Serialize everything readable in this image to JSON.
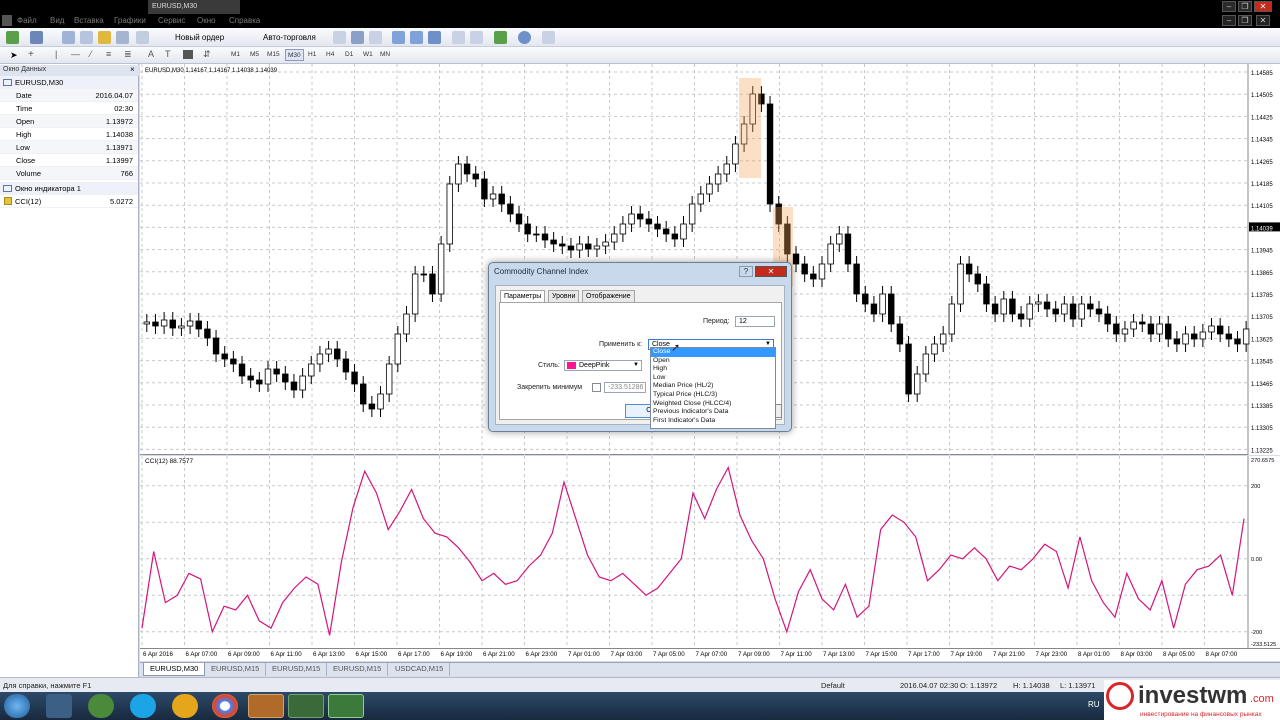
{
  "window": {
    "doc_tab": "EURUSD,M30"
  },
  "menu": [
    "Файл",
    "Вид",
    "Вставка",
    "Графики",
    "Сервис",
    "Окно",
    "Справка"
  ],
  "toolbar1": {
    "new_order": "Новый ордер",
    "auto_trading": "Авто-торговля"
  },
  "timeframes": [
    "M1",
    "M5",
    "M15",
    "M30",
    "H1",
    "H4",
    "D1",
    "W1",
    "MN"
  ],
  "active_timeframe": "M30",
  "datawin": {
    "header": "Окно Данных",
    "symbol": "EURUSD,M30",
    "rows": [
      {
        "k": "Date",
        "v": "2016.04.07"
      },
      {
        "k": "Time",
        "v": "02:30"
      },
      {
        "k": "Open",
        "v": "1.13972"
      },
      {
        "k": "High",
        "v": "1.14038"
      },
      {
        "k": "Low",
        "v": "1.13971"
      },
      {
        "k": "Close",
        "v": "1.13997"
      },
      {
        "k": "Volume",
        "v": "766"
      }
    ],
    "indicator_header": "Окно индикатора 1",
    "indicator_name": "CCI(12)",
    "indicator_value": "5.0272"
  },
  "chart": {
    "header": "EURUSD,M30  1.14167 1.14167 1.14038 1.14039",
    "price_labels": [
      "1.14585",
      "1.14505",
      "1.14425",
      "1.14345",
      "1.14265",
      "1.14185",
      "1.14105",
      "1.14039",
      "1.13945",
      "1.13865",
      "1.13785",
      "1.13705",
      "1.13625",
      "1.13545",
      "1.13465",
      "1.13385",
      "1.13305",
      "1.13225"
    ],
    "current_price": "1.14039",
    "cci_header": "CCI(12) 88.7577",
    "cci_labels": [
      "270.6575",
      "200",
      "0.00",
      "-200",
      "-233.5125"
    ],
    "time_labels": [
      "6 Apr 2016",
      "6 Apr 07:00",
      "6 Apr 09:00",
      "6 Apr 11:00",
      "6 Apr 13:00",
      "6 Apr 15:00",
      "6 Apr 17:00",
      "6 Apr 19:00",
      "6 Apr 21:00",
      "6 Apr 23:00",
      "7 Apr 01:00",
      "7 Apr 03:00",
      "7 Apr 05:00",
      "7 Apr 07:00",
      "7 Apr 09:00",
      "7 Apr 11:00",
      "7 Apr 13:00",
      "7 Apr 15:00",
      "7 Apr 17:00",
      "7 Apr 19:00",
      "7 Apr 21:00",
      "7 Apr 23:00",
      "8 Apr 01:00",
      "8 Apr 03:00",
      "8 Apr 05:00",
      "8 Apr 07:00"
    ],
    "cci_color": "#d4147a"
  },
  "chart_data": {
    "type": "line",
    "title": "CCI(12) 88.7577",
    "series": [
      {
        "name": "CCI(12)",
        "values": [
          -190,
          20,
          -120,
          -100,
          -40,
          -55,
          -200,
          -130,
          -140,
          -100,
          -170,
          -190,
          -120,
          -80,
          -50,
          -70,
          -210,
          -10,
          140,
          240,
          180,
          80,
          130,
          190,
          110,
          70,
          60,
          30,
          -10,
          -60,
          -40,
          -70,
          -60,
          -20,
          10,
          70,
          210,
          110,
          10,
          -50,
          -60,
          -40,
          -70,
          -100,
          -80,
          -40,
          0,
          180,
          110,
          190,
          250,
          120,
          50,
          0,
          -110,
          -200,
          -90,
          -30,
          -110,
          -140,
          -70,
          -160,
          -130,
          80,
          120,
          100,
          60,
          -60,
          -30,
          10,
          0,
          30,
          0,
          -60,
          -20,
          -30,
          0,
          40,
          20,
          -80,
          60,
          -60,
          -120,
          -160,
          -40,
          -110,
          -140,
          -60,
          -190,
          -70,
          -30,
          -20,
          10,
          -100,
          110
        ]
      }
    ],
    "ylim": [
      -233.5125,
      270.6575
    ]
  },
  "chart_tabs": [
    "EURUSD,M30",
    "EURUSD,M15",
    "EURUSD,M15",
    "EURUSD,M15",
    "USDCAD,M15"
  ],
  "status": {
    "help": "Для справки, нажмите F1",
    "profile": "Default",
    "datetime": "2016.04.07 02:30",
    "o": "O: 1.13972",
    "h": "H: 1.14038",
    "l": "L: 1.13971"
  },
  "dialog": {
    "title": "Commodity Channel Index",
    "tabs": [
      "Параметры",
      "Уровни",
      "Отображение"
    ],
    "period_label": "Период:",
    "period_value": "12",
    "apply_label": "Применить к:",
    "apply_value": "Close",
    "style_label": "Стиль:",
    "style_value": "DeepPink",
    "fix_min_label": "Закрепить минимум",
    "fix_min_value": "-233.51286",
    "ok_label": "O",
    "options": [
      "Close",
      "Open",
      "High",
      "Low",
      "Median Price (HL/2)",
      "Typical Price (HLC/3)",
      "Weighted Close (HLCC/4)",
      "Previous Indicator's Data",
      "First Indicator's Data"
    ]
  },
  "taskbar": {
    "lang": "RU"
  },
  "brand": {
    "name": "investwm",
    "suffix": ".com",
    "tagline": "инвестирование на финансовых рынках"
  }
}
